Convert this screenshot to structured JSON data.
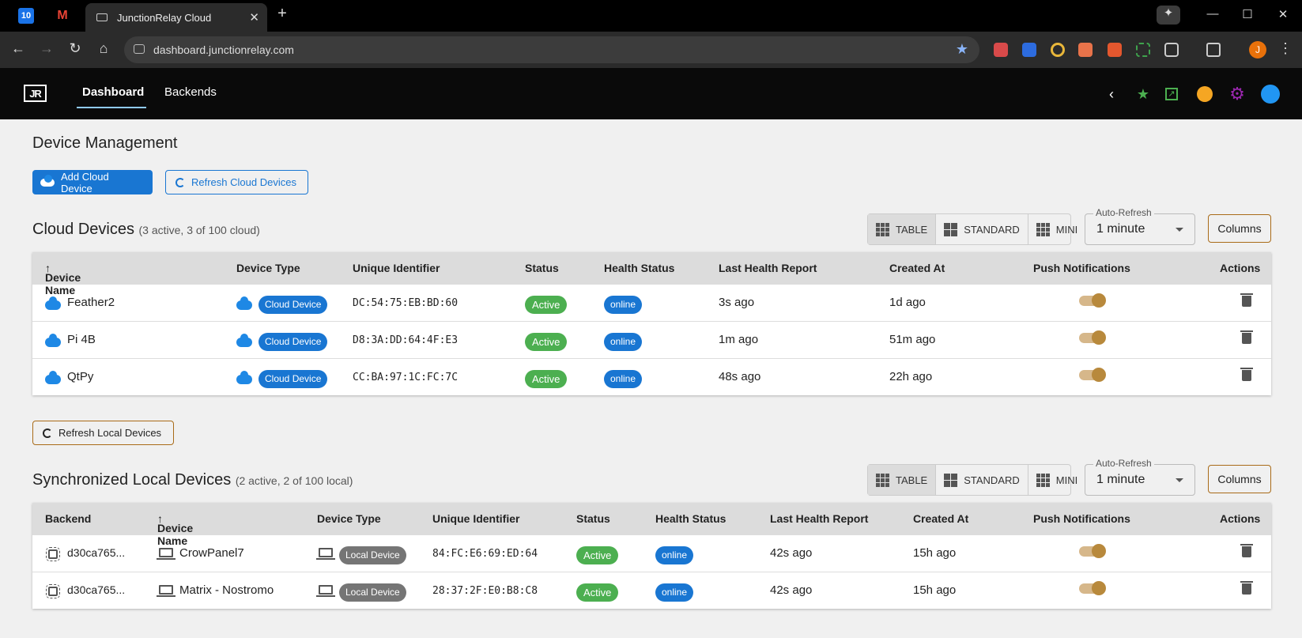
{
  "browser": {
    "tab_title": "JunctionRelay Cloud",
    "url": "dashboard.junctionrelay.com",
    "profile_initial": "J",
    "calendar_label": "10"
  },
  "header": {
    "logo": "JR",
    "tabs": [
      "Dashboard",
      "Backends"
    ]
  },
  "page": {
    "title": "Device Management",
    "add_button": "Add Cloud Device",
    "refresh_cloud_button": "Refresh Cloud Devices",
    "refresh_local_button": "Refresh Local Devices"
  },
  "view_options": {
    "table": "TABLE",
    "standard": "STANDARD",
    "mini": "MINI"
  },
  "auto_refresh": {
    "label": "Auto-Refresh",
    "value": "1 minute"
  },
  "columns_button": "Columns",
  "cloud": {
    "title": "Cloud Devices",
    "summary": "(3 active, 3 of 100 cloud)",
    "headers": [
      "Device Name",
      "Device Type",
      "Unique Identifier",
      "Status",
      "Health Status",
      "Last Health Report",
      "Created At",
      "Push Notifications",
      "Actions"
    ],
    "rows": [
      {
        "name": "Feather2",
        "type": "Cloud Device",
        "uid": "DC:54:75:EB:BD:60",
        "status": "Active",
        "health": "online",
        "last": "3s ago",
        "created": "1d ago"
      },
      {
        "name": "Pi 4B",
        "type": "Cloud Device",
        "uid": "D8:3A:DD:64:4F:E3",
        "status": "Active",
        "health": "online",
        "last": "1m ago",
        "created": "51m ago"
      },
      {
        "name": "QtPy",
        "type": "Cloud Device",
        "uid": "CC:BA:97:1C:FC:7C",
        "status": "Active",
        "health": "online",
        "last": "48s ago",
        "created": "22h ago"
      }
    ]
  },
  "local": {
    "title": "Synchronized Local Devices",
    "summary": "(2 active, 2 of 100 local)",
    "headers": [
      "Backend",
      "Device Name",
      "Device Type",
      "Unique Identifier",
      "Status",
      "Health Status",
      "Last Health Report",
      "Created At",
      "Push Notifications",
      "Actions"
    ],
    "rows": [
      {
        "backend": "d30ca765...",
        "name": "CrowPanel7",
        "type": "Local Device",
        "uid": "84:FC:E6:69:ED:64",
        "status": "Active",
        "health": "online",
        "last": "42s ago",
        "created": "15h ago"
      },
      {
        "backend": "d30ca765...",
        "name": "Matrix - Nostromo",
        "type": "Local Device",
        "uid": "28:37:2F:E0:B8:C8",
        "status": "Active",
        "health": "online",
        "last": "42s ago",
        "created": "15h ago"
      }
    ]
  }
}
